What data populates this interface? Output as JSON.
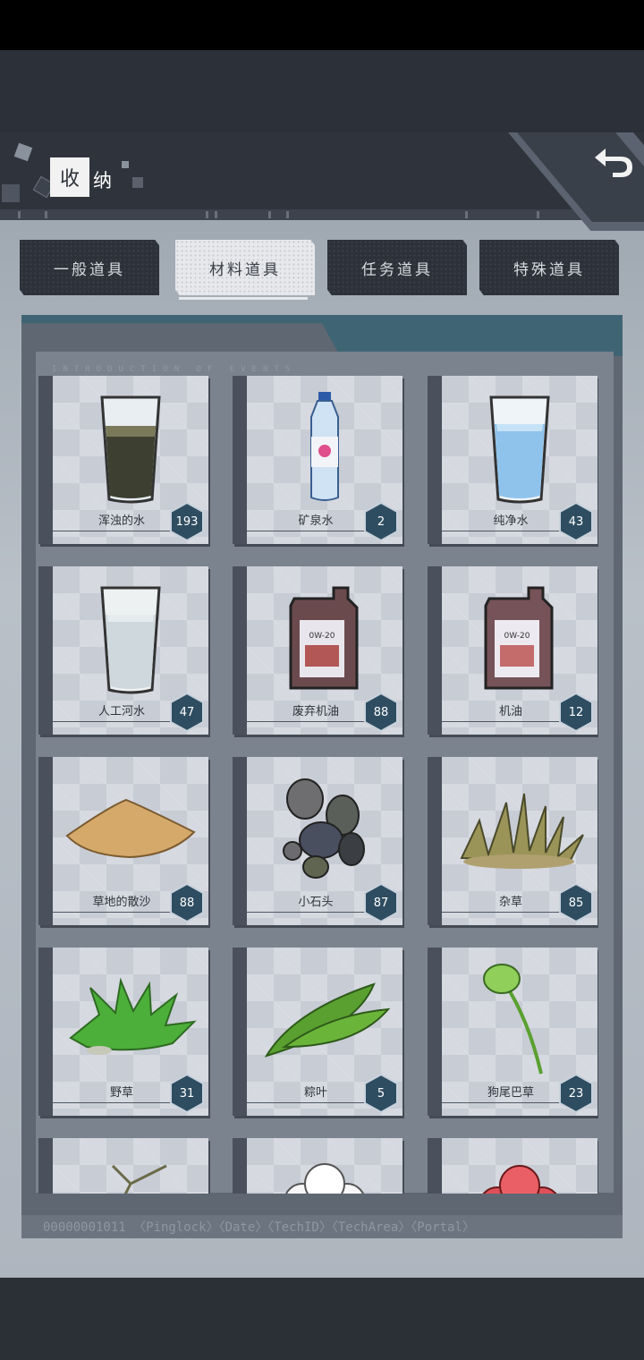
{
  "header": {
    "title_first": "收",
    "title_rest": "纳"
  },
  "tabs": [
    {
      "label": "一般道具",
      "active": false
    },
    {
      "label": "材料道具",
      "active": true
    },
    {
      "label": "任务道具",
      "active": false
    },
    {
      "label": "特殊道具",
      "active": false
    }
  ],
  "panel": {
    "intro": "INTRODUCTION OF EVENTS",
    "footer": "00000001011    〈Pinglock〉〈Date〉〈TechID〉〈TechArea〉〈Portal〉"
  },
  "items": [
    {
      "name": "浑浊的水",
      "count": "193",
      "icon": "muddy-water-glass-icon"
    },
    {
      "name": "矿泉水",
      "count": "2",
      "icon": "water-bottle-icon"
    },
    {
      "name": "纯净水",
      "count": "43",
      "icon": "pure-water-glass-icon"
    },
    {
      "name": "人工河水",
      "count": "47",
      "icon": "river-water-glass-icon"
    },
    {
      "name": "废弃机油",
      "count": "88",
      "icon": "waste-oil-jug-icon"
    },
    {
      "name": "机油",
      "count": "12",
      "icon": "engine-oil-jug-icon"
    },
    {
      "name": "草地的散沙",
      "count": "88",
      "icon": "sand-pile-icon"
    },
    {
      "name": "小石头",
      "count": "87",
      "icon": "pebbles-icon"
    },
    {
      "name": "杂草",
      "count": "85",
      "icon": "weed-icon"
    },
    {
      "name": "野草",
      "count": "31",
      "icon": "wild-grass-icon"
    },
    {
      "name": "粽叶",
      "count": "5",
      "icon": "bamboo-leaf-icon"
    },
    {
      "name": "狗尾巴草",
      "count": "23",
      "icon": "foxtail-grass-icon"
    },
    {
      "name": "",
      "count": "",
      "icon": "dry-herb-icon"
    },
    {
      "name": "",
      "count": "",
      "icon": "white-flower-icon"
    },
    {
      "name": "",
      "count": "",
      "icon": "red-flower-icon"
    }
  ],
  "colors": {
    "count_badge": "#2f4d61",
    "panel_accent": "#3f6574"
  }
}
